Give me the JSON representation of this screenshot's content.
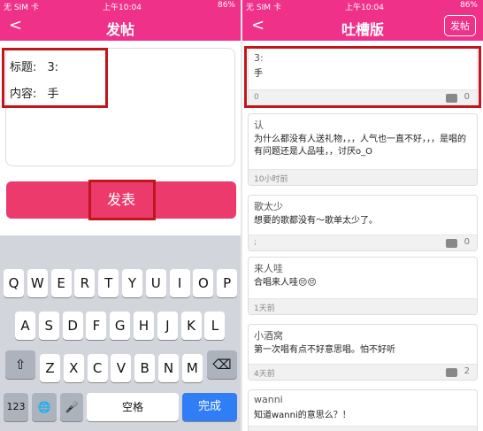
{
  "left": {
    "status": {
      "carrier": "无 SIM 卡",
      "time": "上午10:04",
      "battery": "86%"
    },
    "title": "发帖",
    "form": {
      "title_label": "标题:",
      "title_value": "3:",
      "content_label": "内容:",
      "content_value": "手"
    },
    "submit_label": "发表",
    "keyboard": {
      "row1": [
        "Q",
        "W",
        "E",
        "R",
        "T",
        "Y",
        "U",
        "I",
        "O",
        "P"
      ],
      "row2": [
        "A",
        "S",
        "D",
        "F",
        "G",
        "H",
        "J",
        "K",
        "L"
      ],
      "row3": [
        "Z",
        "X",
        "C",
        "V",
        "B",
        "N",
        "M"
      ],
      "shift": "⇧",
      "delete": "⌫",
      "num": "123",
      "globe": "🌐",
      "mic": "🎤",
      "space": "空格",
      "done": "完成"
    }
  },
  "right": {
    "status": {
      "carrier": "无 SIM 卡",
      "time": "上午10:04",
      "battery": "86%"
    },
    "title": "吐槽版",
    "post_button": "发帖",
    "posts": [
      {
        "name": "3:",
        "body": "手",
        "time": "0",
        "comments": "0"
      },
      {
        "name": "认",
        "body": "为什么都没有人送礼物，，，人气也一直不好，，，是唱的有问题还是人品哇，，讨厌o_O",
        "time": "10小时前",
        "comments": ""
      },
      {
        "name": "歌太少",
        "body": "想要的歌都没有～歌单太少了。",
        "time": ";",
        "comments": "0"
      },
      {
        "name": "来人哇",
        "body": "合唱来人哇😔😔",
        "time": "1天前",
        "comments": ""
      },
      {
        "name": "小酒窝",
        "body": "第一次唱有点不好意思唱。怕不好听",
        "time": "4天前",
        "comments": "2"
      },
      {
        "name": "wanni",
        "body": "知道wanni的意思么？！",
        "time": "",
        "comments": ""
      }
    ]
  }
}
